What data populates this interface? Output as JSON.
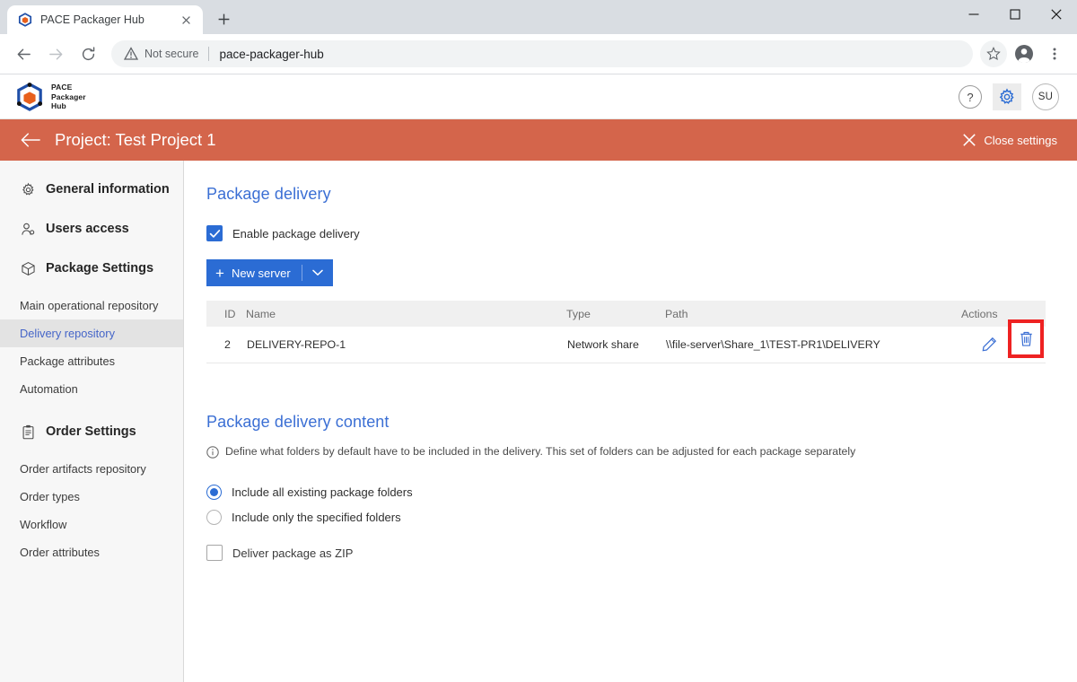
{
  "browser": {
    "tab": {
      "title": "PACE Packager Hub",
      "favicon_icon": "pace-cube-favicon",
      "close_icon": "close-icon"
    },
    "new_tab_label": "+",
    "window_controls": [
      {
        "name": "minimize-button",
        "icon": "minimize-icon"
      },
      {
        "name": "maximize-button",
        "icon": "maximize-icon"
      },
      {
        "name": "close-window-button",
        "icon": "close-icon"
      }
    ],
    "nav": {
      "back_icon": "arrow-left-icon",
      "forward_icon": "arrow-right-icon",
      "reload_icon": "reload-icon"
    },
    "omnibox": {
      "security_icon": "warning-triangle-icon",
      "security_label": "Not secure",
      "url": "pace-packager-hub"
    },
    "toolbar_icons": [
      {
        "name": "bookmark-star-icon",
        "icon": "star-icon"
      },
      {
        "name": "profile-avatar-icon",
        "icon": "person-circle-icon"
      },
      {
        "name": "browser-menu-icon",
        "icon": "three-dots-vertical-icon"
      }
    ]
  },
  "app_header": {
    "logo_icon": "pace-cube-logo",
    "brand_lines": [
      "PACE",
      "Packager",
      "Hub"
    ],
    "help_label": "?",
    "help_icon": "question-mark-icon",
    "settings_icon": "gear-icon",
    "avatar_initials": "SU"
  },
  "banner": {
    "back_icon": "arrow-left-icon",
    "title": "Project: Test Project 1",
    "close_icon": "close-icon",
    "close_label": "Close settings",
    "bg_color": "#d4654b"
  },
  "sidebar": {
    "groups": [
      {
        "label": "General information",
        "icon": "gear-icon",
        "items": []
      },
      {
        "label": "Users access",
        "icon": "users-icon",
        "items": []
      },
      {
        "label": "Package Settings",
        "icon": "cube-icon",
        "items": [
          {
            "label": "Main operational repository",
            "selected": false
          },
          {
            "label": "Delivery repository",
            "selected": true
          },
          {
            "label": "Package attributes",
            "selected": false
          },
          {
            "label": "Automation",
            "selected": false
          }
        ]
      },
      {
        "label": "Order Settings",
        "icon": "clipboard-icon",
        "items": [
          {
            "label": "Order artifacts repository",
            "selected": false
          },
          {
            "label": "Order types",
            "selected": false
          },
          {
            "label": "Workflow",
            "selected": false
          },
          {
            "label": "Order attributes",
            "selected": false
          }
        ]
      }
    ]
  },
  "main": {
    "accent_color": "#3b6fd4",
    "package_delivery": {
      "title": "Package delivery",
      "enable_checkbox": {
        "label": "Enable package delivery",
        "checked": true
      },
      "new_server_button": {
        "plus": "+",
        "label": "New server",
        "caret_icon": "chevron-down-icon"
      },
      "table": {
        "columns": [
          "ID",
          "Name",
          "Type",
          "Path",
          "Actions"
        ],
        "rows": [
          {
            "id": "2",
            "name": "DELIVERY-REPO-1",
            "type": "Network share",
            "path": "\\\\file-server\\Share_1\\TEST-PR1\\DELIVERY",
            "actions": [
              {
                "name": "edit-row-button",
                "icon": "pencil-icon",
                "highlighted": false
              },
              {
                "name": "delete-row-button",
                "icon": "trash-icon",
                "highlighted": true
              }
            ]
          }
        ]
      },
      "highlight_color": "#ee2222"
    },
    "package_delivery_content": {
      "title": "Package delivery content",
      "hint_icon": "info-circle-icon",
      "hint": "Define what folders by default have to be included in the delivery. This set of folders can be adjusted for each package separately",
      "radios": [
        {
          "label": "Include all existing package folders",
          "selected": true
        },
        {
          "label": "Include only the specified folders",
          "selected": false
        }
      ],
      "zip_checkbox": {
        "label": "Deliver package as ZIP",
        "checked": false
      }
    }
  }
}
